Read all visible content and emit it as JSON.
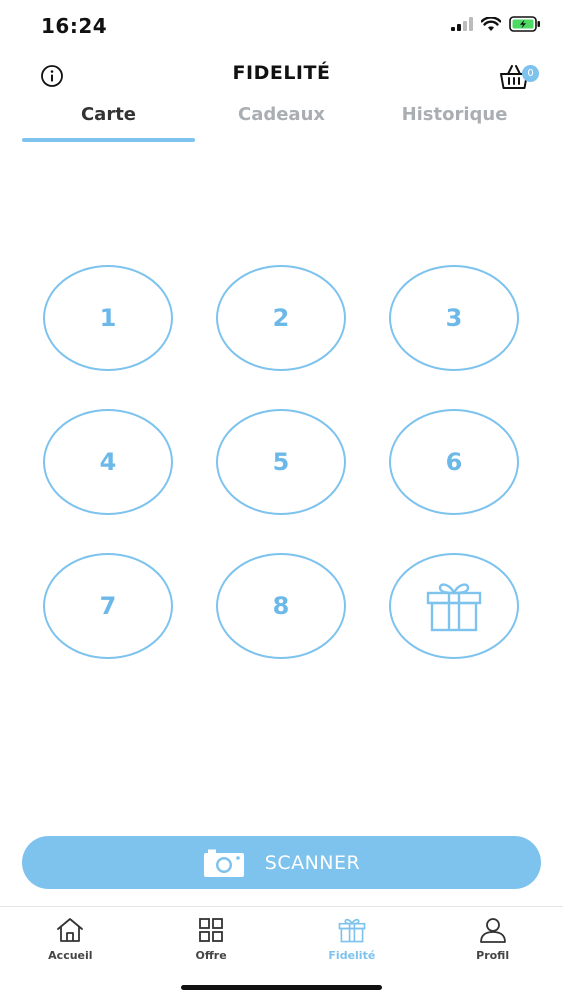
{
  "status_bar": {
    "time": "16:24"
  },
  "header": {
    "title": "FIDELITÉ",
    "cart_count": "0"
  },
  "tabs": [
    {
      "label": "Carte",
      "active": true
    },
    {
      "label": "Cadeaux",
      "active": false
    },
    {
      "label": "Historique",
      "active": false
    }
  ],
  "stamps": {
    "labels": [
      "1",
      "2",
      "3",
      "4",
      "5",
      "6",
      "7",
      "8"
    ],
    "reward_icon": "gift-icon"
  },
  "scanner": {
    "label": "SCANNER",
    "icon": "camera-icon"
  },
  "bottom_nav": [
    {
      "label": "Accueil",
      "icon": "home-icon",
      "active": false
    },
    {
      "label": "Offre",
      "icon": "grid-icon",
      "active": false
    },
    {
      "label": "Fidelité",
      "icon": "gift-icon",
      "active": true
    },
    {
      "label": "Profil",
      "icon": "user-icon",
      "active": false
    }
  ],
  "colors": {
    "accent": "#7dc3ee",
    "inactive_tab": "#a9aeb3"
  }
}
